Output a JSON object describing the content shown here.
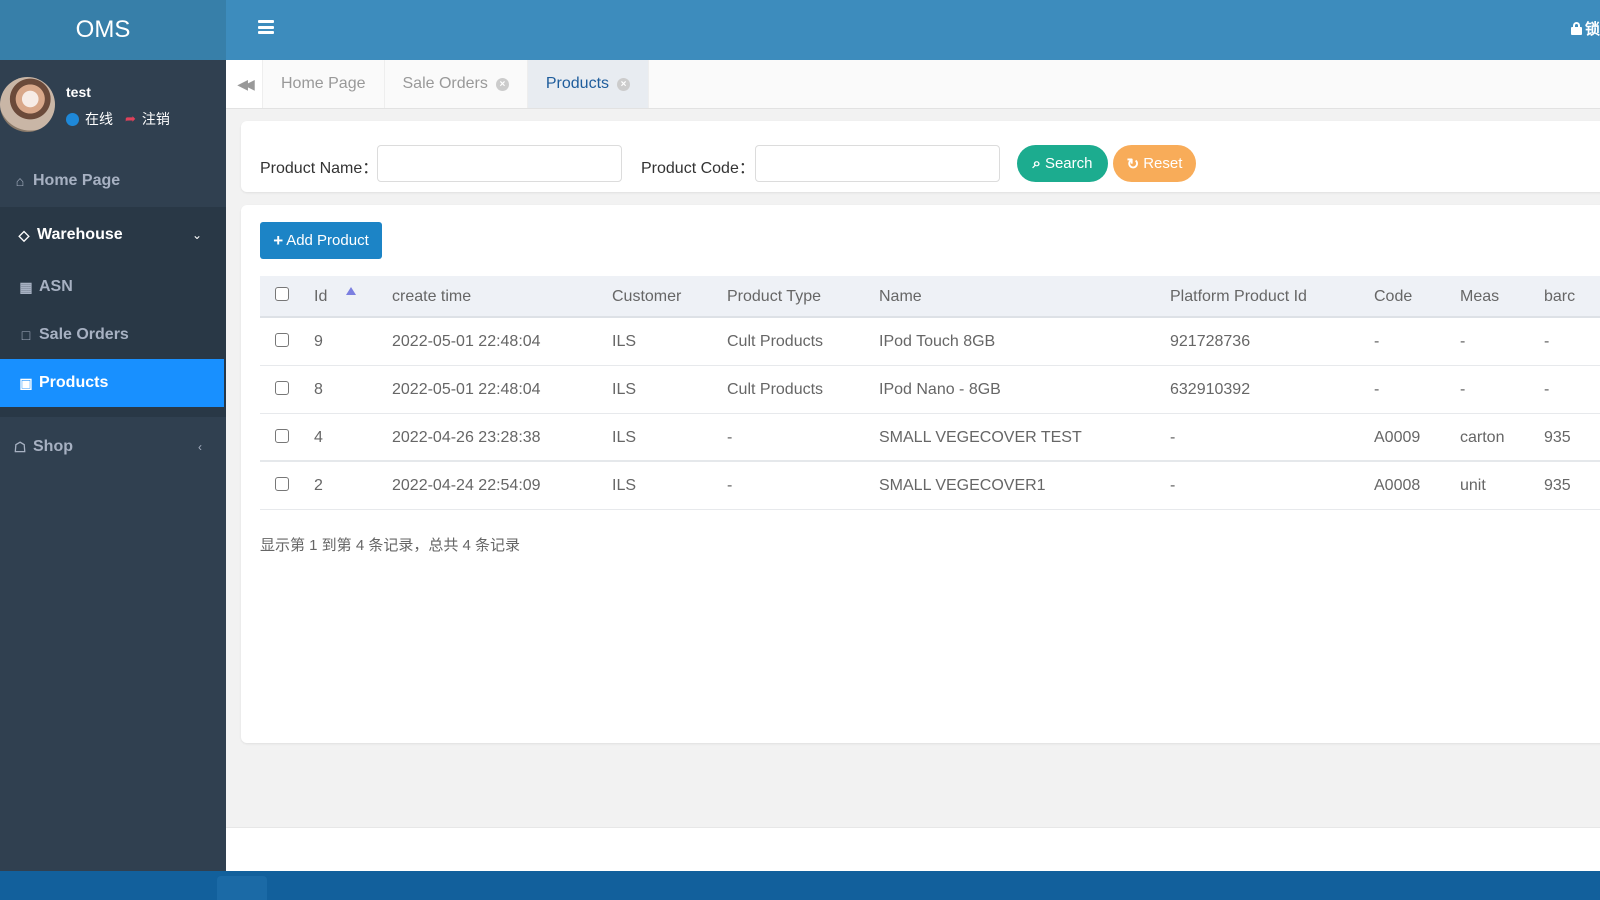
{
  "app": {
    "title": "OMS"
  },
  "user": {
    "name": "test",
    "status": "在线",
    "logout": "注销",
    "status_color": "#1e88d8"
  },
  "sidebar": {
    "home": {
      "label": "Home Page",
      "icon": "home-icon"
    },
    "warehouse": {
      "label": "Warehouse",
      "icon": "diamond-icon",
      "expanded": true,
      "items": [
        {
          "label": "ASN",
          "icon": "calculator-icon"
        },
        {
          "label": "Sale Orders",
          "icon": "sticky-note-icon"
        },
        {
          "label": "Products",
          "icon": "suitcase-icon",
          "active": true
        }
      ]
    },
    "shop": {
      "label": "Shop",
      "icon": "shopping-bag-icon"
    }
  },
  "header": {
    "lock_label": "锁"
  },
  "tabs": [
    {
      "label": "Home Page",
      "closable": false
    },
    {
      "label": "Sale Orders",
      "closable": true
    },
    {
      "label": "Products",
      "closable": true,
      "active": true
    }
  ],
  "search": {
    "product_name_label": "Product Name：",
    "product_name_value": "",
    "product_code_label": "Product Code：",
    "product_code_value": "",
    "search_label": "Search",
    "reset_label": "Reset"
  },
  "toolbar": {
    "add_label": "Add Product"
  },
  "table": {
    "columns": [
      "Id",
      "create time",
      "Customer",
      "Product Type",
      "Name",
      "Platform Product Id",
      "Code",
      "Meas",
      "barc"
    ],
    "sort": {
      "column": "Id",
      "direction": "asc"
    },
    "rows": [
      {
        "id": "9",
        "create_time": "2022-05-01 22:48:04",
        "customer": "ILS",
        "product_type": "Cult Products",
        "name": "IPod Touch 8GB",
        "platform_id": "921728736",
        "code": "-",
        "meas": "-",
        "barcode": "-"
      },
      {
        "id": "8",
        "create_time": "2022-05-01 22:48:04",
        "customer": "ILS",
        "product_type": "Cult Products",
        "name": "IPod Nano - 8GB",
        "platform_id": "632910392",
        "code": "-",
        "meas": "-",
        "barcode": "-"
      },
      {
        "id": "4",
        "create_time": "2022-04-26 23:28:38",
        "customer": "ILS",
        "product_type": "-",
        "name": "SMALL VEGECOVER TEST",
        "platform_id": "-",
        "code": "A0009",
        "meas": "carton",
        "barcode": "935"
      },
      {
        "id": "2",
        "create_time": "2022-04-24 22:54:09",
        "customer": "ILS",
        "product_type": "-",
        "name": "SMALL VEGECOVER1",
        "platform_id": "-",
        "code": "A0008",
        "meas": "unit",
        "barcode": "935"
      }
    ],
    "pagination_info": "显示第 1 到第 4 条记录，总共 4 条记录"
  },
  "colors": {
    "header": "#3d8cbd",
    "logo": "#377fa9",
    "sidebar": "#304050",
    "active_nav": "#1890ff",
    "search_button": "#1cac8f",
    "reset_button": "#f8ac59",
    "add_button": "#1c84c6"
  }
}
